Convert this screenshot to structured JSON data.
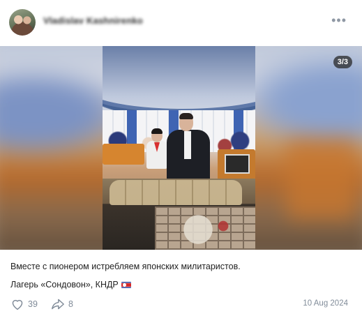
{
  "post": {
    "author_name": "Vladislav Kashnirenko",
    "more_icon": "ellipsis-icon",
    "photo_counter": "3/3",
    "caption": "Вместе с пионером истребляем японских милитаристов.",
    "location": "Лагерь «Сондовон», КНДР",
    "location_flag_icon": "north-korea-flag-icon",
    "likes": "39",
    "shares": "8",
    "date": "10 Aug 2024"
  },
  "colors": {
    "muted": "#818c99",
    "text": "#222222",
    "counter_bg": "#282828"
  }
}
